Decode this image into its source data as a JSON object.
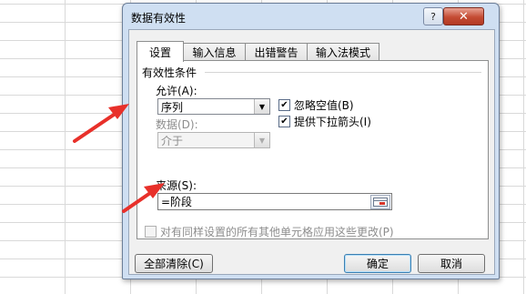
{
  "dialog": {
    "title": "数据有效性",
    "help_icon": "?",
    "close_icon": "✕"
  },
  "tabs": [
    {
      "label": "设置",
      "active": true
    },
    {
      "label": "输入信息",
      "active": false
    },
    {
      "label": "出错警告",
      "active": false
    },
    {
      "label": "输入法模式",
      "active": false
    }
  ],
  "settings": {
    "group_title": "有效性条件",
    "allow_label": "允许(A):",
    "allow_value": "序列",
    "data_label": "数据(D):",
    "data_value": "介于",
    "ignore_blank_label": "忽略空值(B)",
    "ignore_blank_checked": true,
    "dropdown_label": "提供下拉箭头(I)",
    "dropdown_checked": true,
    "source_label": "来源(S):",
    "source_value": "=阶段",
    "apply_all_label": "对有同样设置的所有其他单元格应用这些更改(P)",
    "apply_all_checked": false
  },
  "buttons": {
    "clear_all": "全部清除(C)",
    "ok": "确定",
    "cancel": "取消"
  },
  "colors": {
    "arrow": "#e8302a",
    "dialog_frame": "#cfdff2"
  }
}
